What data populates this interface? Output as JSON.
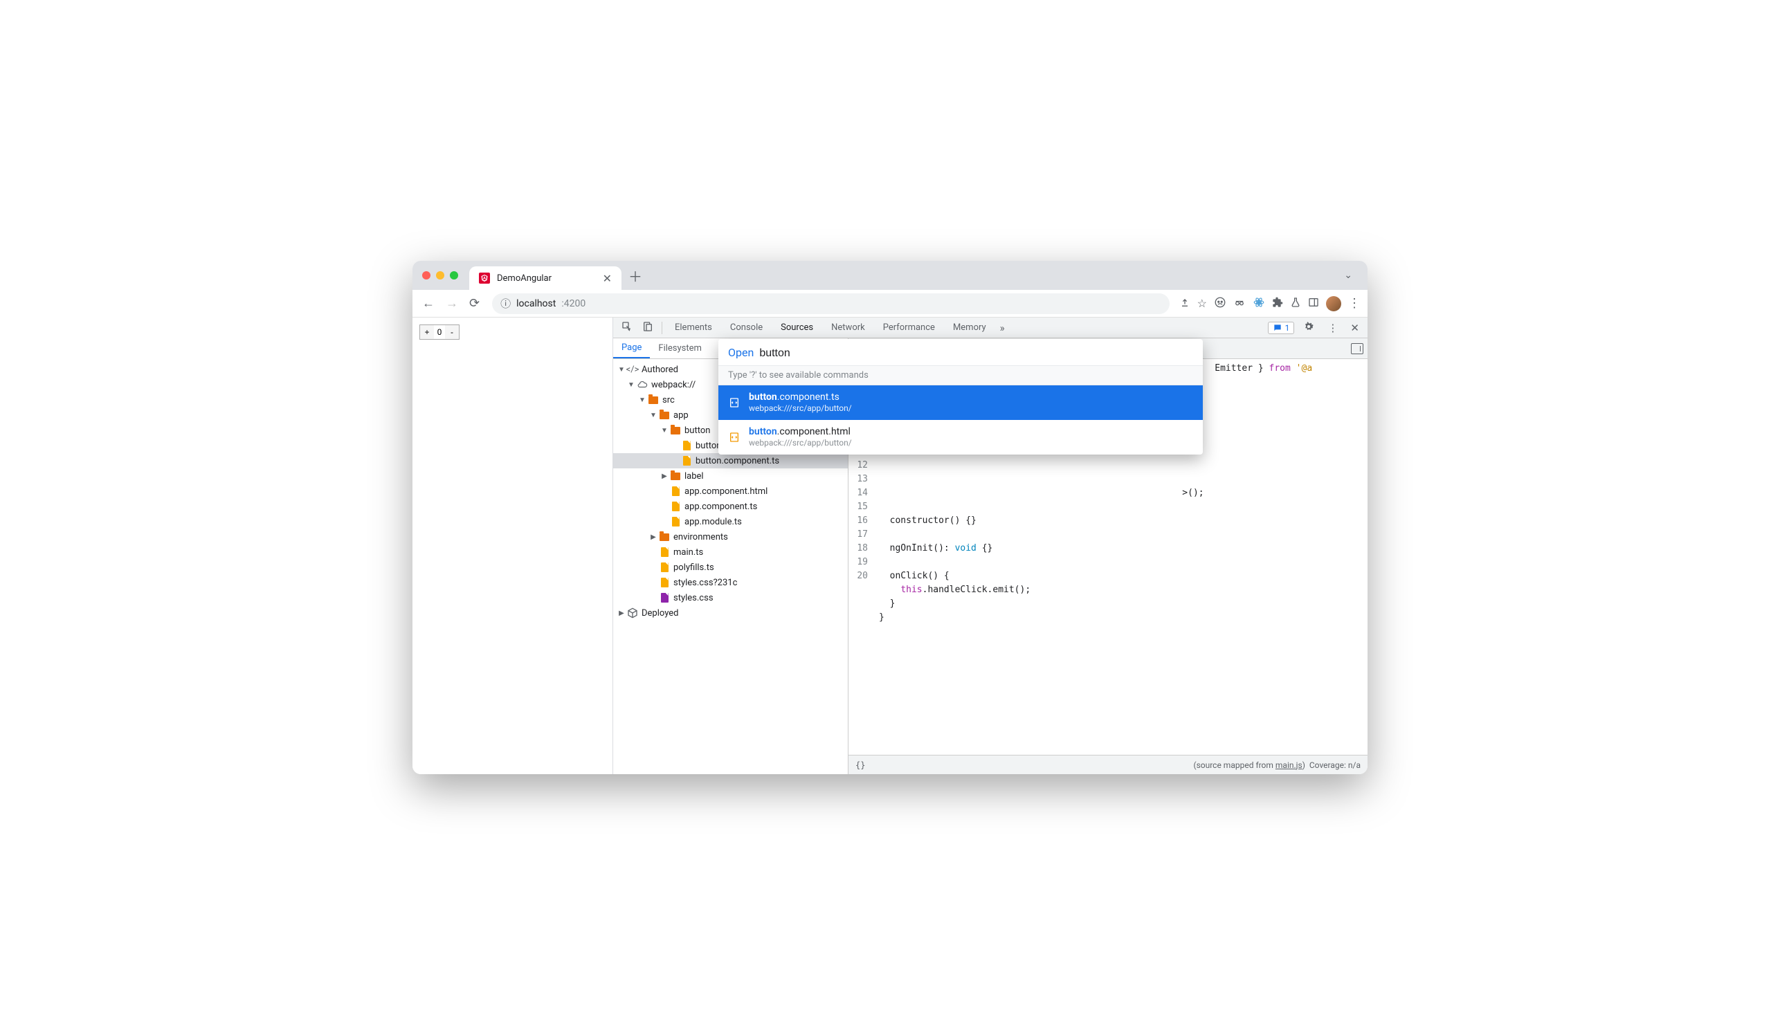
{
  "tab": {
    "title": "DemoAngular"
  },
  "address": {
    "host": "localhost",
    "port": ":4200"
  },
  "page_ctrl": {
    "value": "0"
  },
  "devtools": {
    "tabs": [
      "Elements",
      "Console",
      "Sources",
      "Network",
      "Performance",
      "Memory"
    ],
    "active_tab": "Sources",
    "issues_count": "1",
    "sources_tabs": {
      "page": "Page",
      "filesystem": "Filesystem"
    }
  },
  "tree": {
    "authored": "Authored",
    "webpack": "webpack://",
    "src": "src",
    "app": "app",
    "button_folder": "button",
    "file_html": "button.component.html",
    "file_ts": "button.component.ts",
    "label_folder": "label",
    "app_html": "app.component.html",
    "app_ts": "app.component.ts",
    "app_module": "app.module.ts",
    "environments": "environments",
    "main_ts": "main.ts",
    "polyfills": "polyfills.ts",
    "styles_q": "styles.css?231c",
    "styles": "styles.css",
    "deployed": "Deployed"
  },
  "open": {
    "label": "Open",
    "query": "button",
    "hint": "Type '?' to see available commands",
    "items": [
      {
        "name_hl": "button",
        "name_rest": ".component.ts",
        "path": "webpack:///src/app/button/"
      },
      {
        "name_hl": "button",
        "name_rest": ".component.html",
        "path": "webpack:///src/app/button/"
      }
    ]
  },
  "code": {
    "lines": [
      "",
      "",
      "",
      "",
      "",
      "",
      "",
      "",
      "",
      "",
      "",
      "constructor() {}",
      "",
      "ngOnInit(): void {}",
      "",
      "onClick() {",
      "  this.handleClick.emit();",
      "}",
      "}",
      ""
    ],
    "frag_right": "Emitter } from '@a",
    "frag_output": ">();"
  },
  "footer": {
    "braces": "{}",
    "mapped_prefix": "(source mapped from ",
    "mapped_link": "main.js",
    "mapped_suffix": ")",
    "coverage": "Coverage: n/a"
  }
}
